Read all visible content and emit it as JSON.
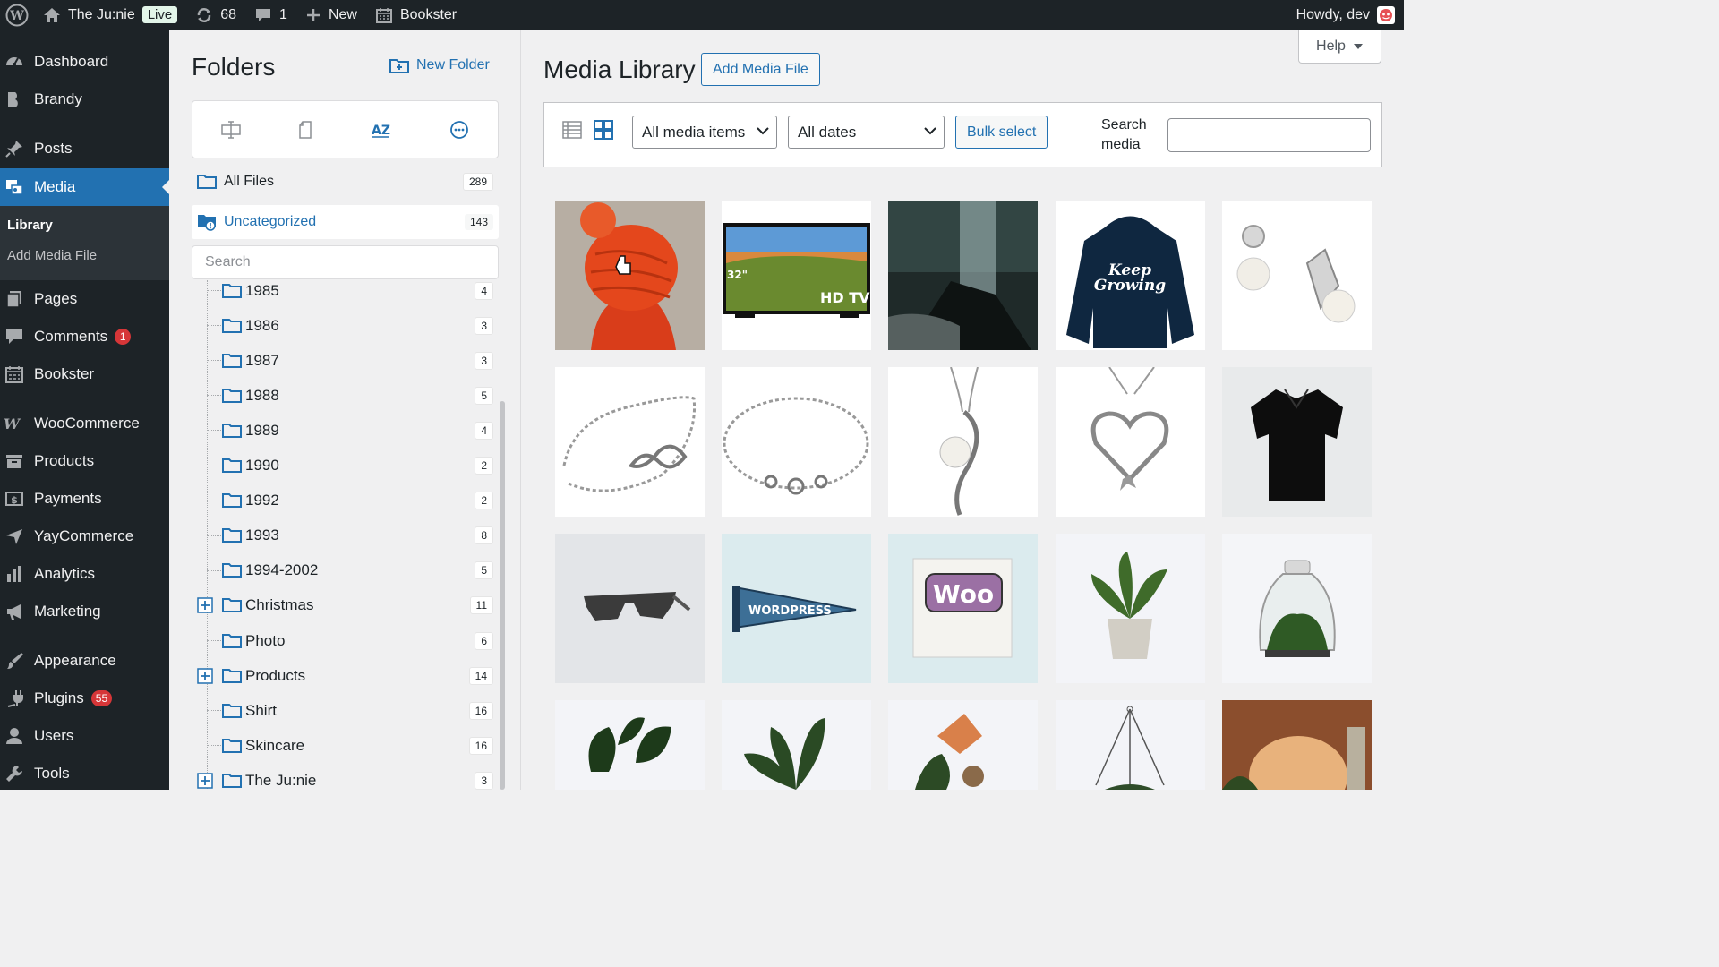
{
  "adminbar": {
    "site_name": "The Ju:nie",
    "live_badge": "Live",
    "updates_count": "68",
    "comments_count": "1",
    "new_label": "New",
    "bookster_label": "Bookster",
    "greeting": "Howdy, dev"
  },
  "sidebar": {
    "items": [
      {
        "label": "Dashboard",
        "icon": "dashboard-icon"
      },
      {
        "label": "Brandy",
        "icon": "brandy-icon"
      },
      {
        "label": "Posts",
        "icon": "pin-icon"
      },
      {
        "label": "Media",
        "icon": "media-icon"
      },
      {
        "label": "Pages",
        "icon": "pages-icon"
      },
      {
        "label": "Comments",
        "icon": "comments-icon",
        "badge": "1"
      },
      {
        "label": "Bookster",
        "icon": "calendar-icon"
      },
      {
        "label": "WooCommerce",
        "icon": "woo-icon"
      },
      {
        "label": "Products",
        "icon": "archive-icon"
      },
      {
        "label": "Payments",
        "icon": "payments-icon"
      },
      {
        "label": "YayCommerce",
        "icon": "yay-icon"
      },
      {
        "label": "Analytics",
        "icon": "bar-chart-icon"
      },
      {
        "label": "Marketing",
        "icon": "megaphone-icon"
      },
      {
        "label": "Appearance",
        "icon": "brush-icon"
      },
      {
        "label": "Plugins",
        "icon": "plug-icon",
        "badge": "55"
      },
      {
        "label": "Users",
        "icon": "user-icon"
      },
      {
        "label": "Tools",
        "icon": "wrench-icon"
      }
    ],
    "submenu": {
      "library": "Library",
      "add_media_file": "Add Media File"
    }
  },
  "folders": {
    "title": "Folders",
    "new_folder": "New Folder",
    "all_files": {
      "label": "All Files",
      "count": "289"
    },
    "uncategorized": {
      "label": "Uncategorized",
      "count": "143"
    },
    "search_placeholder": "Search",
    "tree": [
      {
        "name": "1985",
        "count": "4",
        "expandable": false
      },
      {
        "name": "1986",
        "count": "3",
        "expandable": false
      },
      {
        "name": "1987",
        "count": "3",
        "expandable": false
      },
      {
        "name": "1988",
        "count": "5",
        "expandable": false
      },
      {
        "name": "1989",
        "count": "4",
        "expandable": false
      },
      {
        "name": "1990",
        "count": "2",
        "expandable": false
      },
      {
        "name": "1992",
        "count": "2",
        "expandable": false
      },
      {
        "name": "1993",
        "count": "8",
        "expandable": false
      },
      {
        "name": "1994-2002",
        "count": "5",
        "expandable": false
      },
      {
        "name": "Christmas",
        "count": "11",
        "expandable": true
      },
      {
        "name": "Photo",
        "count": "6",
        "expandable": false
      },
      {
        "name": "Products",
        "count": "14",
        "expandable": true
      },
      {
        "name": "Shirt",
        "count": "16",
        "expandable": false
      },
      {
        "name": "Skincare",
        "count": "16",
        "expandable": false
      },
      {
        "name": "The Ju:nie",
        "count": "3",
        "expandable": true
      }
    ]
  },
  "main": {
    "help_label": "Help",
    "page_title": "Media Library",
    "add_media_label": "Add Media File",
    "filter_type": "All media items",
    "filter_date": "All dates",
    "bulk_select": "Bulk select",
    "search_label": "Search media",
    "tv_label": "HD TV",
    "tv_size": "32\"",
    "woo_text": "Woo",
    "pennant_text": "WORDPRESS"
  },
  "colors": {
    "accent": "#2271b1",
    "admin_dark": "#1d2327",
    "badge_red": "#d63638"
  }
}
